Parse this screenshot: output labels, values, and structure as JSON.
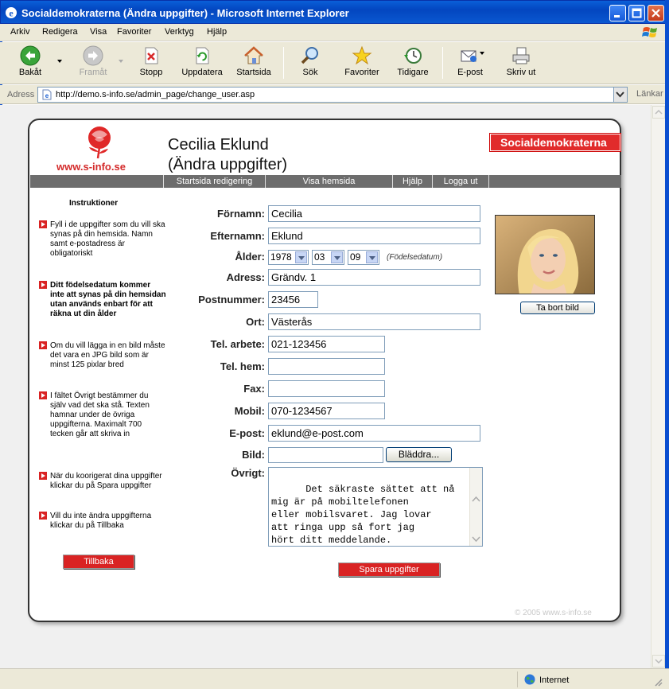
{
  "window": {
    "title": "Socialdemokraterna (Ändra uppgifter) - Microsoft Internet Explorer"
  },
  "menu": {
    "items": [
      "Arkiv",
      "Redigera",
      "Visa",
      "Favoriter",
      "Verktyg",
      "Hjälp"
    ]
  },
  "toolbar": {
    "back": "Bakåt",
    "forward": "Framåt",
    "stop": "Stopp",
    "refresh": "Uppdatera",
    "home": "Startsida",
    "search": "Sök",
    "favorites": "Favoriter",
    "history": "Tidigare",
    "mail": "E-post",
    "print": "Skriv ut"
  },
  "address": {
    "label": "Adress",
    "url": "http://demo.s-info.se/admin_page/change_user.asp",
    "links": "Länkar"
  },
  "status": {
    "zone": "Internet"
  },
  "page": {
    "logo_url": "www.s-info.se",
    "name_line1": "Cecilia Eklund",
    "name_line2": "(Ändra uppgifter)",
    "brand": "Socialdemokraterna",
    "nav": [
      "Startsida redigering",
      "Visa hemsida",
      "Hjälp",
      "Logga ut"
    ],
    "instructions_title": "Instruktioner",
    "instructions": [
      "Fyll i de uppgifter som du vill ska synas på din hemsida. Namn samt e-postadress är obligatoriskt",
      "Ditt födelsedatum kommer inte att synas på din hemsidan utan används enbart för att räkna ut din ålder",
      "Om du vill lägga in en bild måste det vara en JPG bild som är minst 125 pixlar bred",
      "I fältet Övrigt bestämmer du själv vad det ska stå. Texten hamnar under de övriga uppgifterna. Maximalt 700 tecken går att skriva in",
      "När du koorigerat dina uppgifter klickar du på Spara uppgifter",
      "Vill du inte ändra uppgifterna klickar du på Tillbaka"
    ],
    "back_button": "Tillbaka",
    "save_button": "Spara uppgifter",
    "remove_image_button": "Ta bort bild",
    "browse_button": "Bläddra...",
    "birth_hint": "(Födelsedatum)",
    "copyright": "© 2005 www.s-info.se"
  },
  "form": {
    "labels": {
      "firstname": "Förnamn:",
      "lastname": "Efternamn:",
      "age": "Ålder:",
      "address": "Adress:",
      "zip": "Postnummer:",
      "city": "Ort:",
      "work_phone": "Tel. arbete:",
      "home_phone": "Tel. hem:",
      "fax": "Fax:",
      "mobile": "Mobil:",
      "email": "E-post:",
      "image": "Bild:",
      "other": "Övrigt:"
    },
    "values": {
      "firstname": "Cecilia",
      "lastname": "Eklund",
      "birth_year": "1978",
      "birth_month": "03",
      "birth_day": "09",
      "address": "Grändv. 1",
      "zip": "23456",
      "city": "Västerås",
      "work_phone": "021-123456",
      "home_phone": "",
      "fax": "",
      "mobile": "070-1234567",
      "email": "eklund@e-post.com",
      "image": "",
      "other": "Det säkraste sättet att nå\nmig är på mobiltelefonen\neller mobilsvaret. Jag lovar\natt ringa upp så fort jag\nhört ditt meddelande."
    }
  },
  "colors": {
    "accent_red": "#d92323",
    "nav_grey": "#6d6d6d",
    "xp_blue": "#0a4fd0"
  }
}
